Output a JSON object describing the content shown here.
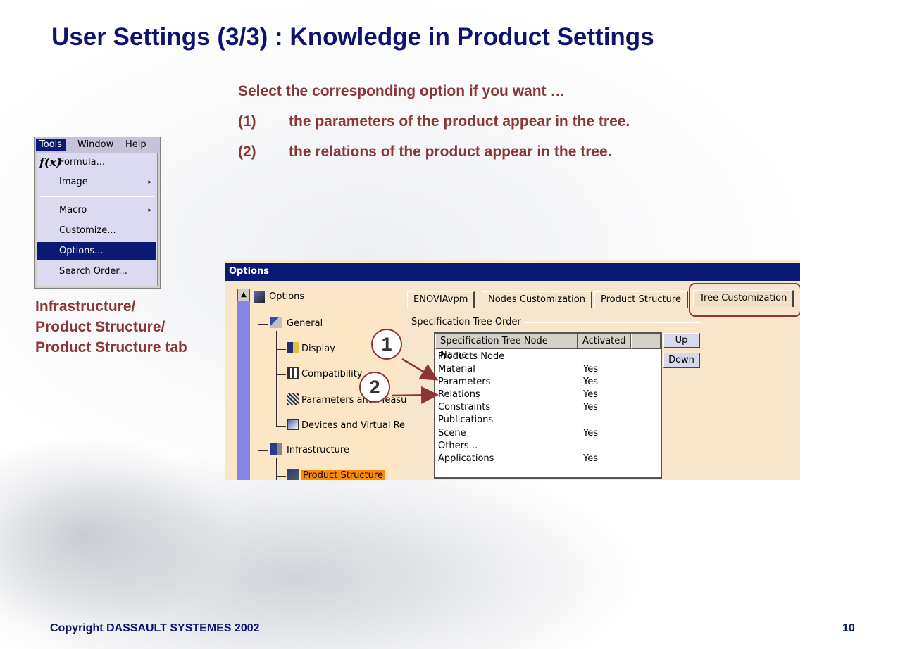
{
  "slide": {
    "title": "User Settings (3/3) : Knowledge in Product Settings",
    "intro": "Select the corresponding option if you want …",
    "points": [
      {
        "num": "(1)",
        "text": "the parameters of the product appear in the tree."
      },
      {
        "num": "(2)",
        "text": "the relations of the product appear in the tree."
      }
    ],
    "caption_lines": [
      "Infrastructure/",
      "Product Structure/",
      "Product Structure tab"
    ],
    "copyright": "Copyright DASSAULT SYSTEMES 2002",
    "page_number": "10"
  },
  "menu": {
    "bar": [
      "Tools",
      "Window",
      "Help"
    ],
    "items": [
      {
        "label": "Formula...",
        "icon": "formula-fx-icon",
        "icon_text": "f(x)"
      },
      {
        "label": "Image",
        "submenu": "▸"
      },
      {
        "label": "Macro",
        "submenu": "▸"
      },
      {
        "label": "Customize..."
      },
      {
        "label": "Options...",
        "selected": true
      },
      {
        "label": "Search Order..."
      }
    ]
  },
  "dialog": {
    "title": "Options",
    "tree": {
      "scroll_up": "▲",
      "nodes": [
        {
          "label": "Options",
          "icon": "options-icon"
        },
        {
          "label": "General",
          "icon": "general-icon"
        },
        {
          "label": "Display",
          "icon": "display-icon"
        },
        {
          "label": "Compatibility",
          "icon": "compatibility-icon"
        },
        {
          "label": "Parameters and Measu",
          "icon": "parameters-icon"
        },
        {
          "label": "Devices and Virtual Re",
          "icon": "devices-icon"
        },
        {
          "label": "Infrastructure",
          "icon": "infrastructure-icon"
        },
        {
          "label": "Product Structure",
          "icon": "product-structure-icon",
          "selected": true
        }
      ]
    },
    "tabs": [
      "ENOVIAvpm",
      "Nodes Customization",
      "Product Structure",
      "Tree Customization"
    ],
    "active_tab": "Tree Customization",
    "group_label": "Specification Tree Order",
    "columns": [
      "Specification Tree Node Name",
      "Activated"
    ],
    "rows": [
      {
        "name": "Products Node",
        "activated": ""
      },
      {
        "name": "Material",
        "activated": "Yes"
      },
      {
        "name": "Parameters",
        "activated": "Yes"
      },
      {
        "name": "Relations",
        "activated": "Yes"
      },
      {
        "name": "Constraints",
        "activated": "Yes"
      },
      {
        "name": "Publications",
        "activated": ""
      },
      {
        "name": "Scene",
        "activated": "Yes"
      },
      {
        "name": "Others...",
        "activated": ""
      },
      {
        "name": "Applications",
        "activated": "Yes"
      }
    ],
    "buttons": {
      "up": "Up",
      "down": "Down"
    }
  },
  "callouts": [
    "1",
    "2"
  ],
  "colors": {
    "title_blue": "#0d1470",
    "accent_red": "#8b3535",
    "selection_blue": "#0a1a74",
    "tree_selection": "#ff8a00"
  }
}
